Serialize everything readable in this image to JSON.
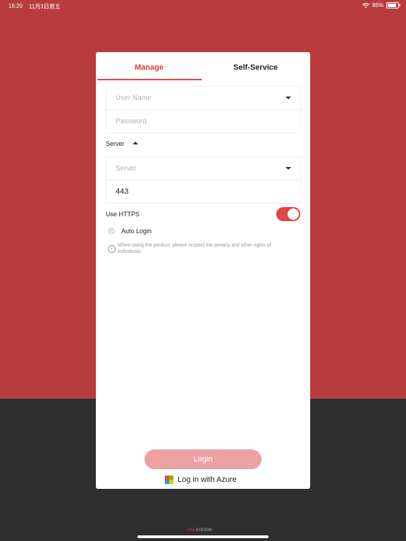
{
  "status_bar": {
    "time": "16:20",
    "date": "11月3日周五",
    "battery_percent": "86%",
    "battery_level": 0.86
  },
  "tabs": [
    {
      "label": "Manage"
    },
    {
      "label": "Self-Service"
    }
  ],
  "form": {
    "username_placeholder": "User Name",
    "password_placeholder": "Password",
    "server_section_label": "Server",
    "server_placeholder": "Server",
    "port_value": "443",
    "https_label": "Use HTTPS",
    "https_enabled": true,
    "auto_login_label": "Auto Login",
    "privacy_notice": "When using the product, please respect the privacy and other rights of individuals."
  },
  "buttons": {
    "login": "Login",
    "azure": "Log in with Azure"
  },
  "brand": {
    "hik": "HIK",
    "vision": "VISION"
  },
  "colors": {
    "accent": "#e04444",
    "background_red": "#b83c3c",
    "background_dark": "#2f2f2f",
    "login_button_disabled": "#eda2a2"
  }
}
